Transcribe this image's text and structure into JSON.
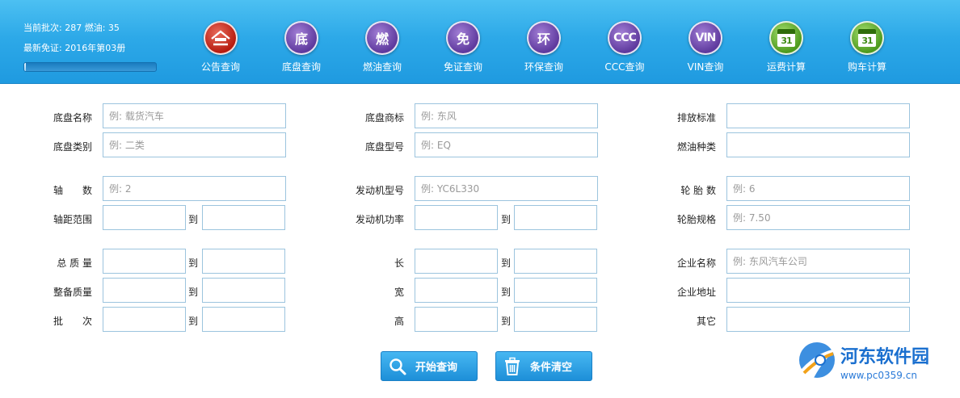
{
  "status": {
    "batch_fuel": "当前批次: 287 燃油: 35",
    "latest_exemption": "最新免证: 2016年第03册",
    "progress": 0.01
  },
  "toolbar": [
    {
      "glyph": "",
      "label": "公告查询",
      "icon": "announcement-icon",
      "color": "red"
    },
    {
      "glyph": "底",
      "label": "底盘查询",
      "icon": "chassis-icon",
      "color": "purple"
    },
    {
      "glyph": "燃",
      "label": "燃油查询",
      "icon": "fuel-icon",
      "color": "purple"
    },
    {
      "glyph": "免",
      "label": "免证查询",
      "icon": "exemption-icon",
      "color": "purple"
    },
    {
      "glyph": "环",
      "label": "环保查询",
      "icon": "environment-icon",
      "color": "purple"
    },
    {
      "glyph": "CCC",
      "label": "CCC查询",
      "icon": "ccc-icon",
      "color": "purple"
    },
    {
      "glyph": "VIN",
      "label": "VIN查询",
      "icon": "vin-icon",
      "color": "purple"
    },
    {
      "glyph": "31",
      "label": "运费计算",
      "icon": "calendar-icon",
      "color": "green"
    },
    {
      "glyph": "31",
      "label": "购车计算",
      "icon": "calendar-icon",
      "color": "green"
    }
  ],
  "form": {
    "range_to": "到",
    "chassis_name": {
      "label": "底盘名称",
      "placeholder": "例: 载货汽车"
    },
    "chassis_type": {
      "label": "底盘类别",
      "placeholder": "例: 二类"
    },
    "axle_count": {
      "label": "轴　　数",
      "placeholder": "例: 2"
    },
    "wheelbase": {
      "label": "轴距范围"
    },
    "total_mass": {
      "label": "总 质 量"
    },
    "curb_mass": {
      "label": "整备质量"
    },
    "batch": {
      "label": "批　　次"
    },
    "chassis_brand": {
      "label": "底盘商标",
      "placeholder": "例: 东风"
    },
    "chassis_model": {
      "label": "底盘型号",
      "placeholder": "例: EQ"
    },
    "engine_model": {
      "label": "发动机型号",
      "placeholder": "例: YC6L330"
    },
    "engine_power": {
      "label": "发动机功率"
    },
    "length": {
      "label": "长"
    },
    "width": {
      "label": "宽"
    },
    "height": {
      "label": "高"
    },
    "emission": {
      "label": "排放标准",
      "placeholder": ""
    },
    "fuel_type": {
      "label": "燃油种类",
      "placeholder": ""
    },
    "tire_count": {
      "label": "轮 胎 数",
      "placeholder": "例: 6"
    },
    "tire_spec": {
      "label": "轮胎规格",
      "placeholder": "例: 7.50"
    },
    "company_name": {
      "label": "企业名称",
      "placeholder": "例: 东风汽车公司"
    },
    "company_address": {
      "label": "企业地址",
      "placeholder": ""
    },
    "other": {
      "label": "其它",
      "placeholder": ""
    }
  },
  "buttons": {
    "search": "开始查询",
    "clear": "条件清空"
  },
  "watermark": {
    "name": "河东软件园",
    "url": "www.pc0359.cn"
  }
}
